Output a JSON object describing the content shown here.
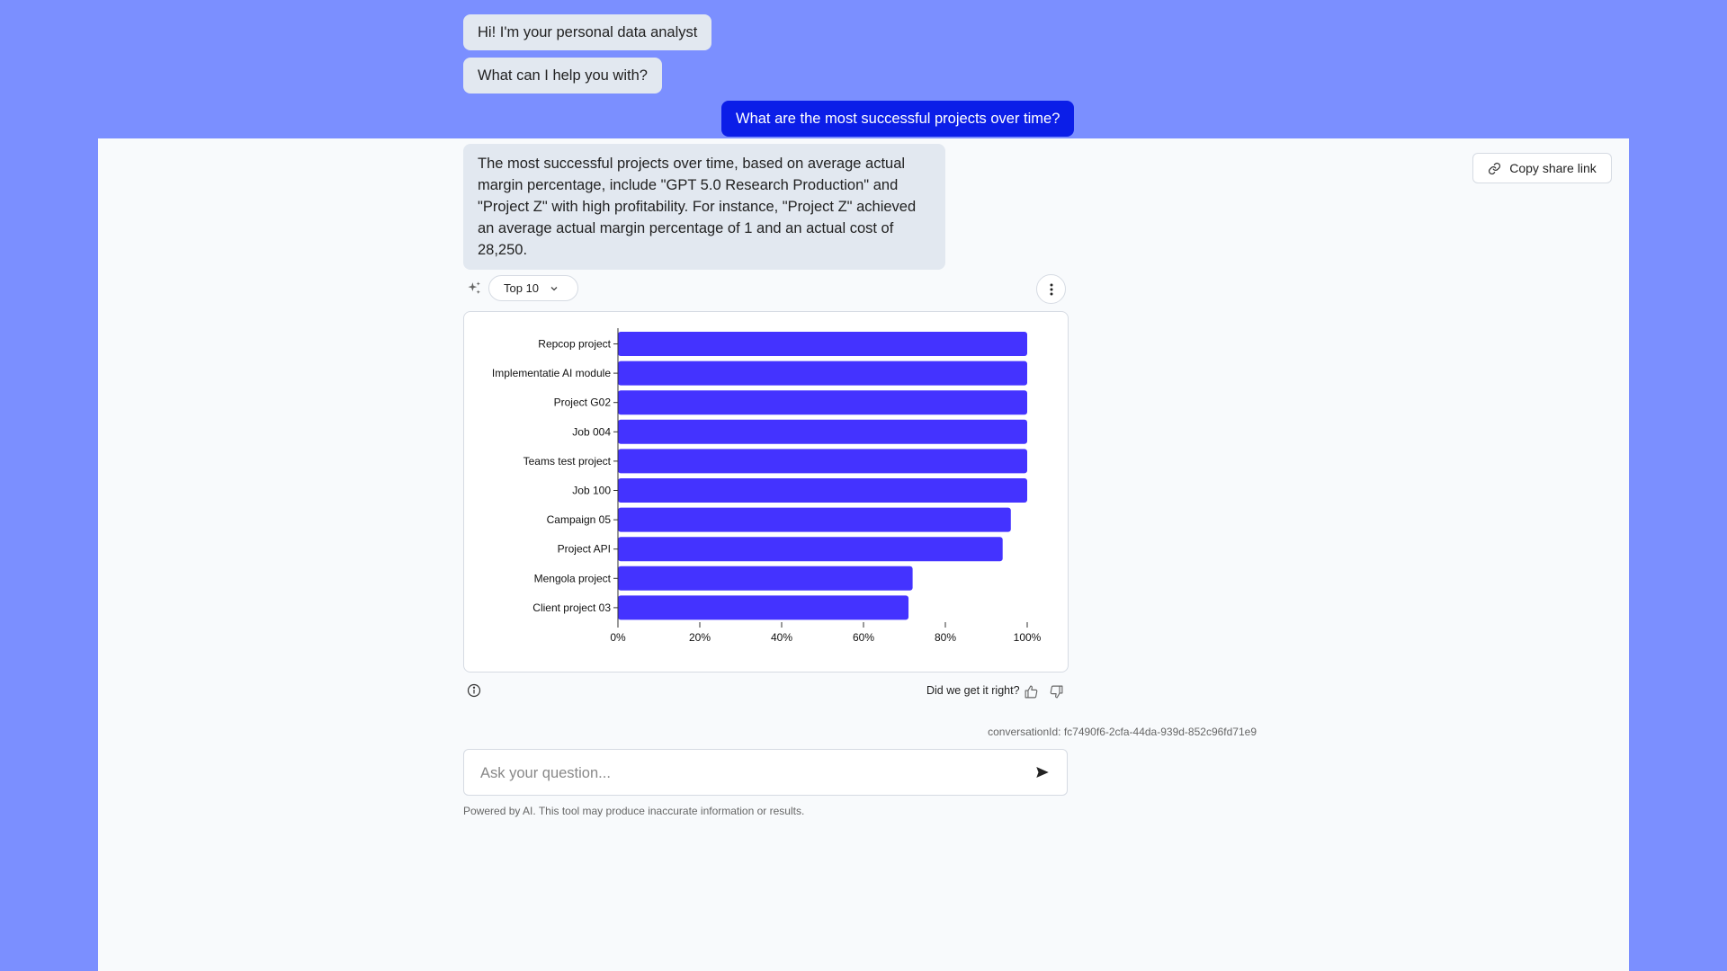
{
  "header": {
    "copy_share_label": "Copy share link",
    "copy_icon": "link-icon"
  },
  "messages": [
    {
      "role": "assistant",
      "text": "Hi! I'm your personal data analyst"
    },
    {
      "role": "assistant",
      "text": "What can I help you with?"
    },
    {
      "role": "user",
      "text": "What are the most successful projects over time?"
    },
    {
      "role": "assistant",
      "text": "The most successful projects over time, based on average actual margin percentage, include \"GPT 5.0 Research Production\" and \"Project Z\" with high profitability. For instance, \"Project Z\" achieved an average actual margin percentage of 1 and an actual cost of 28,250."
    }
  ],
  "controls": {
    "sparkle_icon": "sparkle-icon",
    "top_label": "Top 10",
    "more_icon": "more-vertical-icon"
  },
  "chart_data": {
    "type": "bar",
    "orientation": "horizontal",
    "categories": [
      "Repcop project",
      "Implementatie AI module",
      "Project G02",
      "Job 004",
      "Teams test project",
      "Job 100",
      "Campaign 05",
      "Project API",
      "Mengola project",
      "Client project 03"
    ],
    "values": [
      100,
      100,
      100,
      100,
      100,
      100,
      96,
      94,
      72,
      71
    ],
    "xlim": [
      0,
      100
    ],
    "xticks": [
      "0%",
      "20%",
      "40%",
      "60%",
      "80%",
      "100%"
    ],
    "xtick_values": [
      0,
      20,
      40,
      60,
      80,
      100
    ],
    "bar_color": "#4433ff",
    "title": "",
    "xlabel": "",
    "ylabel": ""
  },
  "feedback": {
    "label": "Did we get it right?",
    "up_icon": "thumbs-up-icon",
    "down_icon": "thumbs-down-icon"
  },
  "conversation_id": "conversationId: fc7490f6-2cfa-44da-939d-852c96fd71e9",
  "input": {
    "placeholder": "Ask your question...",
    "value": "",
    "send_icon": "send-icon"
  },
  "footer": {
    "disclaimer": "Powered by AI. This tool may produce inaccurate information or results."
  }
}
